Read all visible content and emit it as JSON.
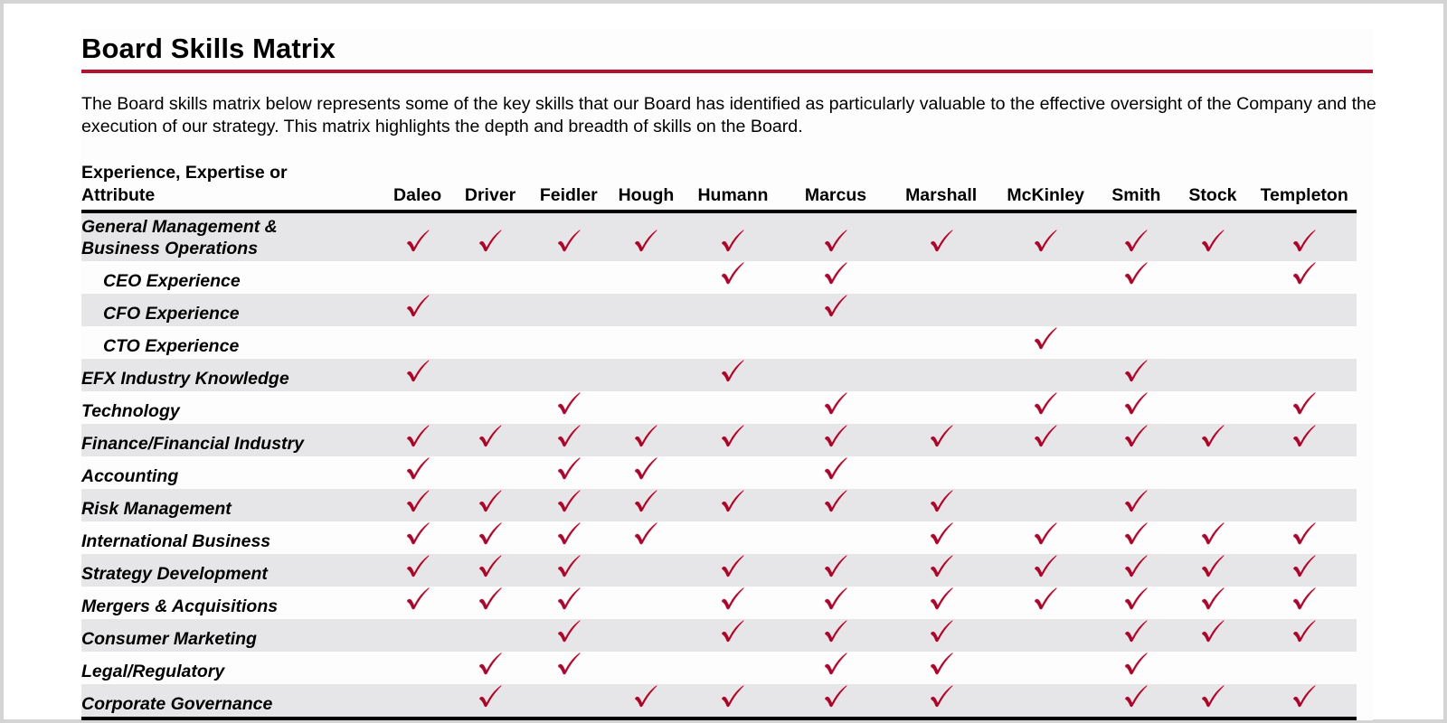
{
  "title": "Board Skills Matrix",
  "intro": "The Board skills matrix below represents some of the key skills that our Board has identified as particularly valuable to the effective oversight of the Company and the execution of our strategy. This matrix highlights the depth and breadth of skills on the Board.",
  "accent_color": "#b5112f",
  "check_color": "#a50a2e",
  "matrix": {
    "attribute_header": "Experience, Expertise or Attribute",
    "attribute_header_line1": "Experience, Expertise or",
    "attribute_header_line2": "Attribute",
    "check_icon": "checkmark-icon",
    "directors": [
      "Daleo",
      "Driver",
      "Feidler",
      "Hough",
      "Humann",
      "Marcus",
      "Marshall",
      "McKinley",
      "Smith",
      "Stock",
      "Templeton"
    ],
    "rows": [
      {
        "label": "General Management & Business Operations",
        "label_line1": "General Management &",
        "label_line2": "Business Operations",
        "indent": false,
        "checks": [
          true,
          true,
          true,
          true,
          true,
          true,
          true,
          true,
          true,
          true,
          true
        ]
      },
      {
        "label": "CEO Experience",
        "indent": true,
        "checks": [
          false,
          false,
          false,
          false,
          true,
          true,
          false,
          false,
          true,
          false,
          true
        ]
      },
      {
        "label": "CFO Experience",
        "indent": true,
        "checks": [
          true,
          false,
          false,
          false,
          false,
          true,
          false,
          false,
          false,
          false,
          false
        ]
      },
      {
        "label": "CTO Experience",
        "indent": true,
        "checks": [
          false,
          false,
          false,
          false,
          false,
          false,
          false,
          true,
          false,
          false,
          false
        ]
      },
      {
        "label": "EFX Industry Knowledge",
        "indent": false,
        "checks": [
          true,
          false,
          false,
          false,
          true,
          false,
          false,
          false,
          true,
          false,
          false
        ]
      },
      {
        "label": "Technology",
        "indent": false,
        "checks": [
          false,
          false,
          true,
          false,
          false,
          true,
          false,
          true,
          true,
          false,
          true
        ]
      },
      {
        "label": "Finance/Financial Industry",
        "indent": false,
        "checks": [
          true,
          true,
          true,
          true,
          true,
          true,
          true,
          true,
          true,
          true,
          true
        ]
      },
      {
        "label": "Accounting",
        "indent": false,
        "checks": [
          true,
          false,
          true,
          true,
          false,
          true,
          false,
          false,
          false,
          false,
          false
        ]
      },
      {
        "label": "Risk Management",
        "indent": false,
        "checks": [
          true,
          true,
          true,
          true,
          true,
          true,
          true,
          false,
          true,
          false,
          false
        ]
      },
      {
        "label": "International Business",
        "indent": false,
        "checks": [
          true,
          true,
          true,
          true,
          false,
          false,
          true,
          true,
          true,
          true,
          true
        ]
      },
      {
        "label": "Strategy Development",
        "indent": false,
        "checks": [
          true,
          true,
          true,
          false,
          true,
          true,
          true,
          true,
          true,
          true,
          true
        ]
      },
      {
        "label": "Mergers & Acquisitions",
        "indent": false,
        "checks": [
          true,
          true,
          true,
          false,
          true,
          true,
          true,
          true,
          true,
          true,
          true
        ]
      },
      {
        "label": "Consumer Marketing",
        "indent": false,
        "checks": [
          false,
          false,
          true,
          false,
          true,
          true,
          true,
          false,
          true,
          true,
          true
        ]
      },
      {
        "label": "Legal/Regulatory",
        "indent": false,
        "checks": [
          false,
          true,
          true,
          false,
          false,
          true,
          true,
          false,
          true,
          false,
          false
        ]
      },
      {
        "label": "Corporate Governance",
        "indent": false,
        "checks": [
          false,
          true,
          false,
          true,
          true,
          true,
          true,
          false,
          true,
          true,
          true
        ]
      }
    ]
  }
}
